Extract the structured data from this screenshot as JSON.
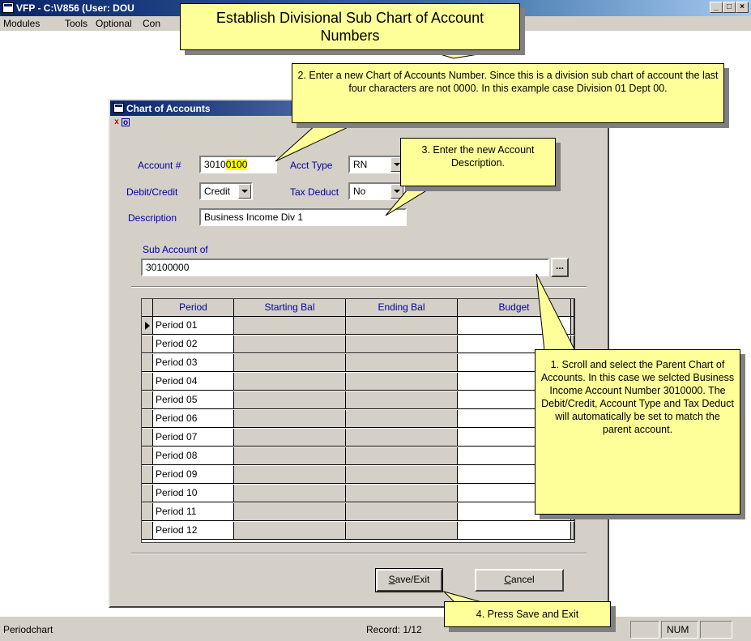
{
  "window": {
    "title": "VFP - C:\\V856 (User: DOU",
    "minimize_glyph": "_",
    "maximize_glyph": "□",
    "close_glyph": "×"
  },
  "menu": [
    "Modules",
    "Tools",
    "Optional",
    "Con"
  ],
  "dialog": {
    "title": "Chart of Accounts",
    "close_glyph": "x",
    "restore_glyph": "o",
    "account_label": "Account #",
    "account_prefix": "3010",
    "account_highlight": "0100",
    "acct_type_label": "Acct Type",
    "acct_type_value": "RN",
    "debit_credit_label": "Debit/Credit",
    "debit_credit_value": "Credit",
    "tax_deduct_label": "Tax Deduct",
    "tax_deduct_value": "No",
    "description_label": "Description",
    "description_value": "Business Income Div 1",
    "sub_account_label": "Sub Account of",
    "sub_account_value": "30100000",
    "browse_label": "...",
    "grid": {
      "headers": [
        "Period",
        "Starting Bal",
        "Ending Bal",
        "Budget"
      ],
      "rows": [
        "Period 01",
        "Period 02",
        "Period 03",
        "Period 04",
        "Period 05",
        "Period 06",
        "Period 07",
        "Period 08",
        "Period 09",
        "Period 10",
        "Period 11",
        "Period 12"
      ]
    },
    "save_mnemonic": "S",
    "save_rest": "ave/Exit",
    "cancel_mnemonic": "C",
    "cancel_rest": "ancel"
  },
  "status": {
    "left": "Periodchart",
    "record": "Record: 1/12",
    "num": "NUM"
  },
  "callouts": {
    "title": "Establish Divisional Sub Chart of Account Numbers",
    "step2": "2. Enter a new Chart of Accounts Number.  Since this is a division sub chart of account the last four characters are not 0000.  In this example case Division 01 Dept 00.",
    "step3": "3. Enter the new Account Description.",
    "step1": "1. Scroll and select the Parent Chart of Accounts.  In this case we selcted Business Income Account Number 3010000.  The Debit/Credit, Account Type and Tax Deduct will automatically be set to match the parent account.",
    "step4": "4. Press Save and Exit"
  },
  "colors": {
    "callout_fill": "#ffff99",
    "highlight": "#ffff00",
    "label_blue": "#0000a0",
    "titlebar": "#0a246a"
  }
}
